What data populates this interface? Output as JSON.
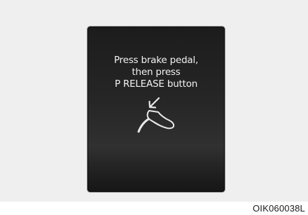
{
  "display": {
    "message_lines": [
      "Press brake pedal,",
      "then press",
      "P RELEASE button"
    ],
    "icon": "foot-on-brake-pedal-icon"
  },
  "caption": "OIK060038L",
  "colors": {
    "panel_background": "#efefef",
    "display_background": "#232323",
    "display_text": "#f2f2f2"
  }
}
